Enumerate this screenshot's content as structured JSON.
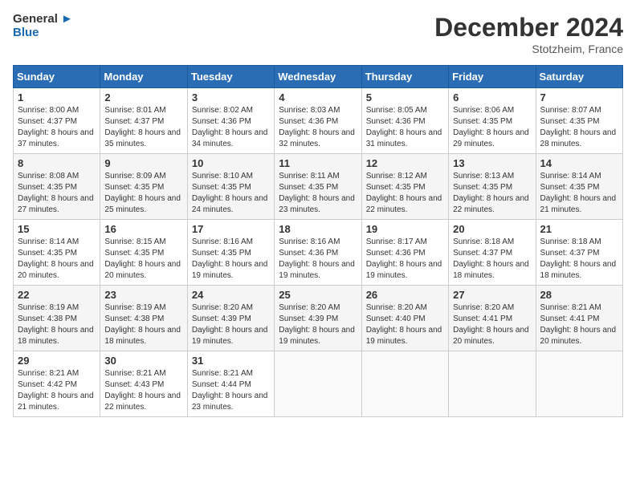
{
  "logo": {
    "line1": "General",
    "line2": "Blue"
  },
  "title": "December 2024",
  "location": "Stotzheim, France",
  "days_of_week": [
    "Sunday",
    "Monday",
    "Tuesday",
    "Wednesday",
    "Thursday",
    "Friday",
    "Saturday"
  ],
  "weeks": [
    [
      {
        "num": "1",
        "sunrise": "8:00 AM",
        "sunset": "4:37 PM",
        "daylight": "8 hours and 37 minutes."
      },
      {
        "num": "2",
        "sunrise": "8:01 AM",
        "sunset": "4:37 PM",
        "daylight": "8 hours and 35 minutes."
      },
      {
        "num": "3",
        "sunrise": "8:02 AM",
        "sunset": "4:36 PM",
        "daylight": "8 hours and 34 minutes."
      },
      {
        "num": "4",
        "sunrise": "8:03 AM",
        "sunset": "4:36 PM",
        "daylight": "8 hours and 32 minutes."
      },
      {
        "num": "5",
        "sunrise": "8:05 AM",
        "sunset": "4:36 PM",
        "daylight": "8 hours and 31 minutes."
      },
      {
        "num": "6",
        "sunrise": "8:06 AM",
        "sunset": "4:35 PM",
        "daylight": "8 hours and 29 minutes."
      },
      {
        "num": "7",
        "sunrise": "8:07 AM",
        "sunset": "4:35 PM",
        "daylight": "8 hours and 28 minutes."
      }
    ],
    [
      {
        "num": "8",
        "sunrise": "8:08 AM",
        "sunset": "4:35 PM",
        "daylight": "8 hours and 27 minutes."
      },
      {
        "num": "9",
        "sunrise": "8:09 AM",
        "sunset": "4:35 PM",
        "daylight": "8 hours and 25 minutes."
      },
      {
        "num": "10",
        "sunrise": "8:10 AM",
        "sunset": "4:35 PM",
        "daylight": "8 hours and 24 minutes."
      },
      {
        "num": "11",
        "sunrise": "8:11 AM",
        "sunset": "4:35 PM",
        "daylight": "8 hours and 23 minutes."
      },
      {
        "num": "12",
        "sunrise": "8:12 AM",
        "sunset": "4:35 PM",
        "daylight": "8 hours and 22 minutes."
      },
      {
        "num": "13",
        "sunrise": "8:13 AM",
        "sunset": "4:35 PM",
        "daylight": "8 hours and 22 minutes."
      },
      {
        "num": "14",
        "sunrise": "8:14 AM",
        "sunset": "4:35 PM",
        "daylight": "8 hours and 21 minutes."
      }
    ],
    [
      {
        "num": "15",
        "sunrise": "8:14 AM",
        "sunset": "4:35 PM",
        "daylight": "8 hours and 20 minutes."
      },
      {
        "num": "16",
        "sunrise": "8:15 AM",
        "sunset": "4:35 PM",
        "daylight": "8 hours and 20 minutes."
      },
      {
        "num": "17",
        "sunrise": "8:16 AM",
        "sunset": "4:35 PM",
        "daylight": "8 hours and 19 minutes."
      },
      {
        "num": "18",
        "sunrise": "8:16 AM",
        "sunset": "4:36 PM",
        "daylight": "8 hours and 19 minutes."
      },
      {
        "num": "19",
        "sunrise": "8:17 AM",
        "sunset": "4:36 PM",
        "daylight": "8 hours and 19 minutes."
      },
      {
        "num": "20",
        "sunrise": "8:18 AM",
        "sunset": "4:37 PM",
        "daylight": "8 hours and 18 minutes."
      },
      {
        "num": "21",
        "sunrise": "8:18 AM",
        "sunset": "4:37 PM",
        "daylight": "8 hours and 18 minutes."
      }
    ],
    [
      {
        "num": "22",
        "sunrise": "8:19 AM",
        "sunset": "4:38 PM",
        "daylight": "8 hours and 18 minutes."
      },
      {
        "num": "23",
        "sunrise": "8:19 AM",
        "sunset": "4:38 PM",
        "daylight": "8 hours and 18 minutes."
      },
      {
        "num": "24",
        "sunrise": "8:20 AM",
        "sunset": "4:39 PM",
        "daylight": "8 hours and 19 minutes."
      },
      {
        "num": "25",
        "sunrise": "8:20 AM",
        "sunset": "4:39 PM",
        "daylight": "8 hours and 19 minutes."
      },
      {
        "num": "26",
        "sunrise": "8:20 AM",
        "sunset": "4:40 PM",
        "daylight": "8 hours and 19 minutes."
      },
      {
        "num": "27",
        "sunrise": "8:20 AM",
        "sunset": "4:41 PM",
        "daylight": "8 hours and 20 minutes."
      },
      {
        "num": "28",
        "sunrise": "8:21 AM",
        "sunset": "4:41 PM",
        "daylight": "8 hours and 20 minutes."
      }
    ],
    [
      {
        "num": "29",
        "sunrise": "8:21 AM",
        "sunset": "4:42 PM",
        "daylight": "8 hours and 21 minutes."
      },
      {
        "num": "30",
        "sunrise": "8:21 AM",
        "sunset": "4:43 PM",
        "daylight": "8 hours and 22 minutes."
      },
      {
        "num": "31",
        "sunrise": "8:21 AM",
        "sunset": "4:44 PM",
        "daylight": "8 hours and 23 minutes."
      },
      null,
      null,
      null,
      null
    ]
  ],
  "labels": {
    "sunrise": "Sunrise:",
    "sunset": "Sunset:",
    "daylight": "Daylight:"
  }
}
